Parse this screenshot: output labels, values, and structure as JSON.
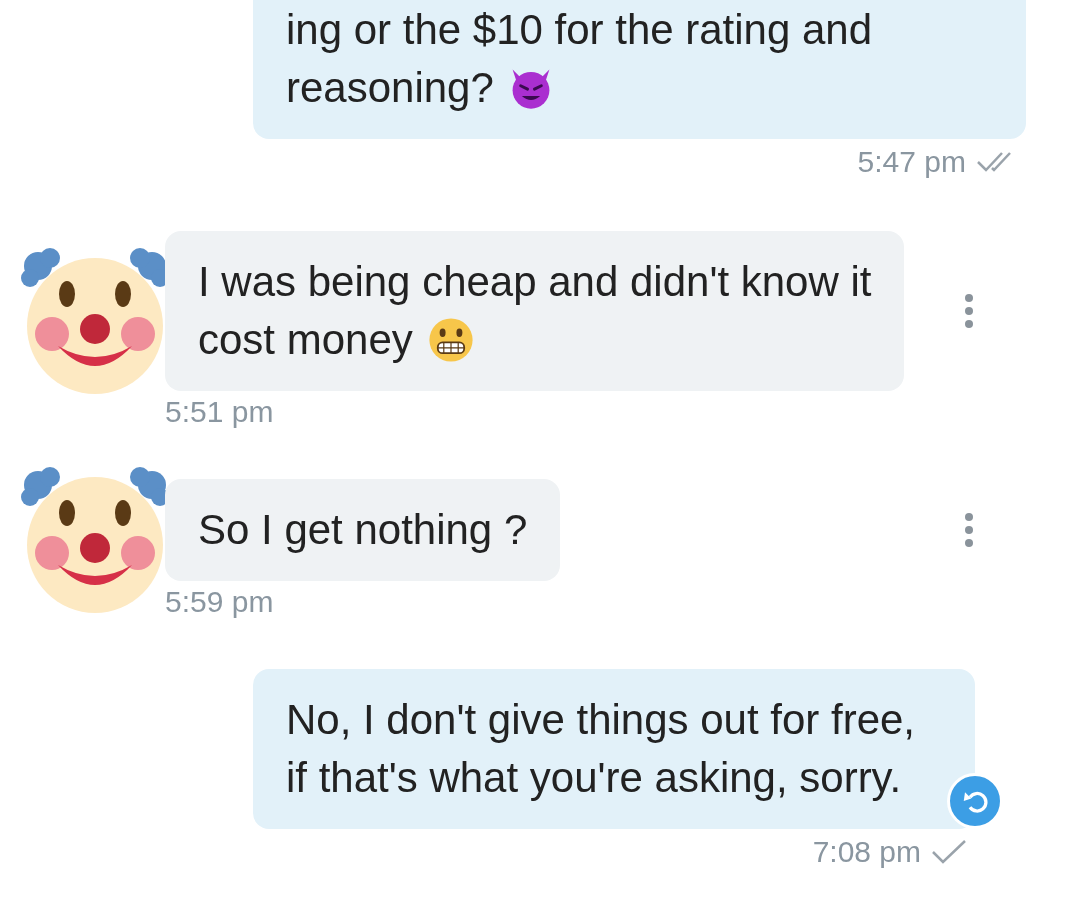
{
  "messages": [
    {
      "kind": "sent",
      "lines": [
        "ing or the $10 for the rating and",
        "reasoning?"
      ],
      "emoji": {
        "kind": "devil"
      },
      "time": "5:47 pm",
      "read": true,
      "undo": false
    },
    {
      "kind": "received",
      "lines": [
        "I was being cheap and didn't know it",
        "cost money"
      ],
      "emoji": {
        "kind": "grimace"
      },
      "time": "5:51 pm",
      "menu": true
    },
    {
      "kind": "received",
      "lines": [
        "So I get nothing ?"
      ],
      "time": "5:59 pm",
      "menu": true
    },
    {
      "kind": "sent",
      "lines": [
        "No, I don't give things out for free,",
        "if that's what you're asking, sorry."
      ],
      "time": "7:08 pm",
      "read": false,
      "undo": true
    }
  ]
}
